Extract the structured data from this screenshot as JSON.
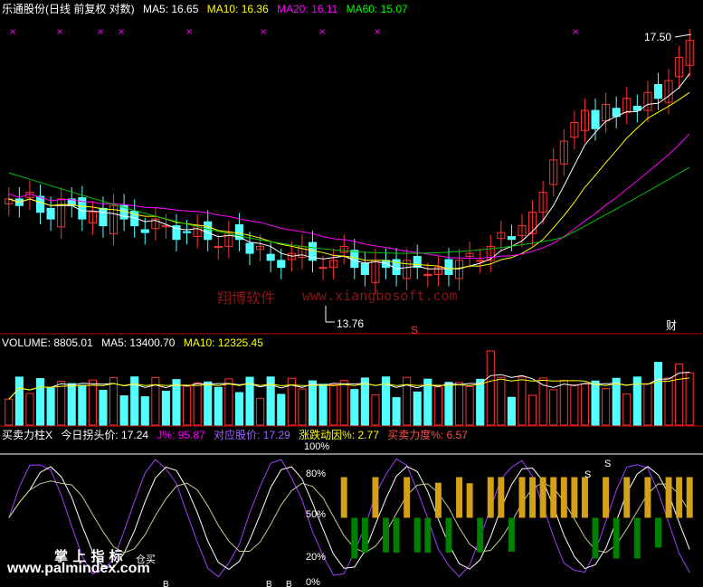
{
  "header": {
    "stock_title": "乐通股份(日线 前复权 对数)",
    "ma5": "MA5: 16.65",
    "ma10": "MA10: 16.36",
    "ma20": "MA20: 16.11",
    "ma60": "MA60: 15.07"
  },
  "volume_header": {
    "label": "VOLUME: 8805.01",
    "ma5": "MA5: 13400.70",
    "ma10": "MA10: 12325.45"
  },
  "indicator_header": {
    "name": "买卖力柱X",
    "turn": "今日拐头价: 17.24",
    "j": "J%: 95.87",
    "corr": "对应股价: 17.29",
    "move": "涨跌动因%: 2.77",
    "force": "买卖力度%: 6.57"
  },
  "annotations": {
    "high": "17.50",
    "low": "13.76",
    "cai": "财",
    "s_marker": "S",
    "s_top": "S",
    "b_bottom": "B"
  },
  "levels": {
    "l100": "100%",
    "l80": "80%",
    "l50": "50%",
    "l20": "20%",
    "l0": "0%"
  },
  "watermarks": {
    "site_cn": "翔博软件",
    "site_url": "www.xiangbosoft.com",
    "logo_cn": "掌 上 指 标",
    "logo_small": "仓买",
    "logo_url": "www.palmindex.com"
  },
  "colors": {
    "up": "#ff3232",
    "down": "#54ffff",
    "ma5": "#ffffff",
    "ma10": "#ffff00",
    "ma20": "#ff00ff",
    "ma60": "#00c000",
    "grid": "#c00000",
    "buy_bar": "#d4a017",
    "sell_bar": "#008000",
    "j_line": "#a040ff"
  },
  "chart_data": {
    "type": "candlestick",
    "title": "乐通股份(日线 前复权 对数)",
    "price_range": [
      13.2,
      17.9
    ],
    "high_label": 17.5,
    "low_label": 13.76,
    "close_series": [
      14.9,
      14.8,
      15.0,
      14.7,
      14.6,
      14.9,
      14.8,
      14.6,
      14.7,
      14.5,
      14.8,
      14.6,
      14.5,
      14.4,
      14.6,
      14.5,
      14.3,
      14.4,
      14.5,
      14.3,
      14.2,
      14.4,
      14.3,
      14.1,
      14.2,
      14.0,
      13.9,
      14.1,
      14.2,
      14.0,
      13.9,
      14.0,
      14.2,
      13.9,
      13.8,
      14.0,
      13.9,
      13.8,
      14.0,
      13.9,
      13.8,
      13.9,
      13.8,
      14.0,
      14.1,
      14.0,
      14.2,
      14.4,
      14.3,
      14.5,
      14.7,
      15.0,
      15.5,
      15.8,
      16.1,
      16.3,
      16.0,
      16.4,
      16.2,
      16.5,
      16.3,
      16.6,
      16.5,
      16.8,
      17.2,
      17.5
    ],
    "ma5_last": 16.65,
    "ma10_last": 16.36,
    "ma20_last": 16.11,
    "ma60_last": 15.07,
    "volume": {
      "label": "VOLUME",
      "last": 8805.01,
      "ma5_last": 13400.7,
      "ma10_last": 12325.45
    },
    "indicator": {
      "name": "买卖力柱X",
      "j_last": 95.87,
      "levels": [
        0,
        20,
        50,
        80,
        100
      ]
    }
  }
}
